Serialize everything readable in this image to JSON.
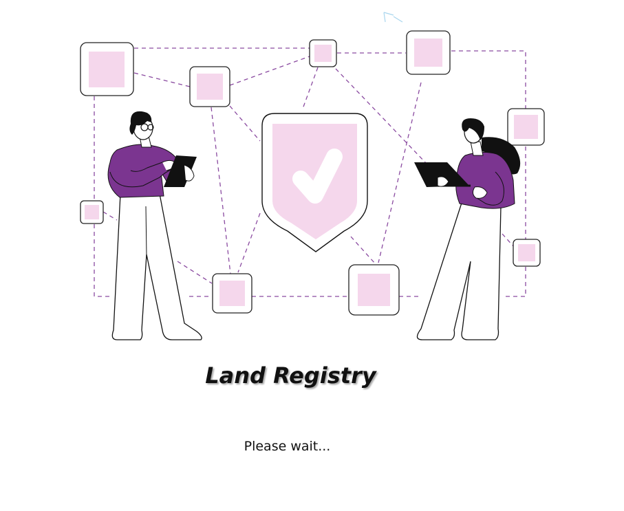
{
  "app": {
    "title": "Land Registry",
    "status": "Please wait..."
  },
  "theme": {
    "accent_purple": "#7b3590",
    "node_fill": "#f5d7ec",
    "line_color": "#8a4aa0",
    "ink": "#111111"
  },
  "illustration": {
    "subject": "two-people-network-security",
    "center_icon": "shield-check-icon"
  }
}
